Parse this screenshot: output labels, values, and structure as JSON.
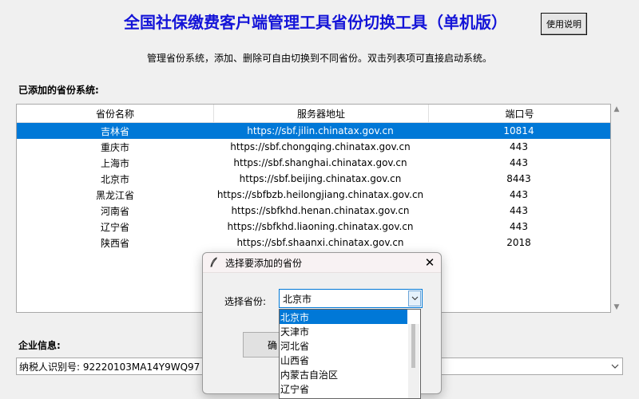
{
  "header": {
    "title": "全国社保缴费客户端管理工具省份切换工具（单机版）",
    "help_button": "使用说明",
    "subtitle": "管理省份系统，添加、删除可自由切换到不同省份。双击列表项可直接启动系统。"
  },
  "list_section": {
    "label": "已添加的省份系统:",
    "columns": [
      "省份名称",
      "服务器地址",
      "端口号"
    ],
    "rows": [
      {
        "name": "吉林省",
        "server": "https://sbf.jilin.chinatax.gov.cn",
        "port": "10814",
        "selected": true
      },
      {
        "name": "重庆市",
        "server": "https://sbf.chongqing.chinatax.gov.cn",
        "port": "443"
      },
      {
        "name": "上海市",
        "server": "https://sbf.shanghai.chinatax.gov.cn",
        "port": "443"
      },
      {
        "name": "北京市",
        "server": "https://sbf.beijing.chinatax.gov.cn",
        "port": "8443"
      },
      {
        "name": "黑龙江省",
        "server": "https://sbfbzb.heilongjiang.chinatax.gov.cn",
        "port": "443"
      },
      {
        "name": "河南省",
        "server": "https://sbfkhd.henan.chinatax.gov.cn",
        "port": "443"
      },
      {
        "name": "辽宁省",
        "server": "https://sbfkhd.liaoning.chinatax.gov.cn",
        "port": "443"
      },
      {
        "name": "陕西省",
        "server": "https://sbf.shaanxi.chinatax.gov.cn",
        "port": "2018"
      }
    ]
  },
  "company_section": {
    "label": "企业信息:",
    "value": "纳税人识别号: 92220103MA14Y9WQ97 纳"
  },
  "dialog": {
    "title": "选择要添加的省份",
    "field_label": "选择省份:",
    "selected_value": "北京市",
    "confirm_label": "确",
    "options": [
      "北京市",
      "天津市",
      "河北省",
      "山西省",
      "内蒙古自治区",
      "辽宁省"
    ]
  }
}
